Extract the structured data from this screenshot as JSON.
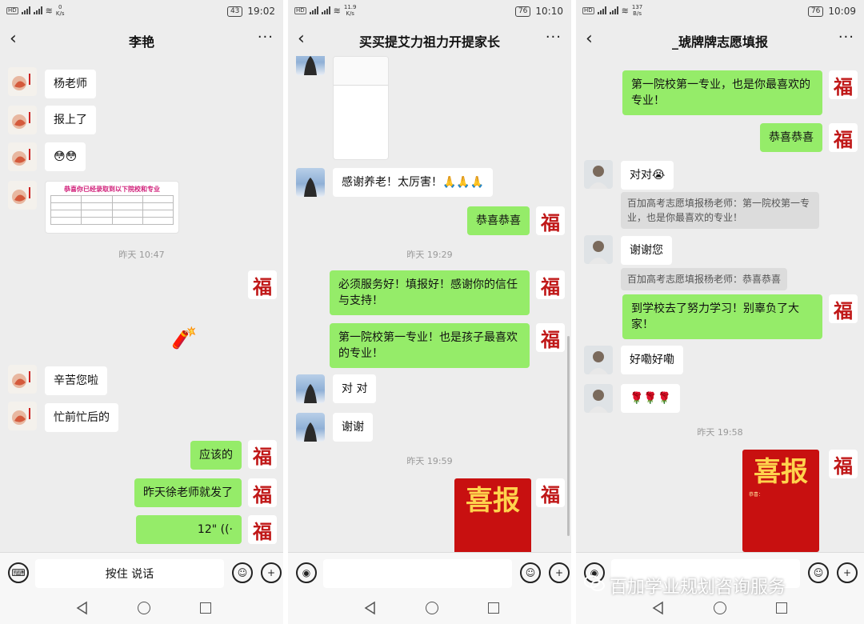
{
  "panels": [
    {
      "status": {
        "net": "0",
        "unit": "K/s",
        "battery": "43",
        "time": "19:02"
      },
      "title": "李艳",
      "messages": {
        "m1": "杨老师",
        "m2": "报上了",
        "m3": "😳😳",
        "card_title": "恭喜你已经录取到以下院校和专业",
        "time1": "昨天 10:47",
        "m5": "辛苦您啦",
        "m6": "忙前忙后的",
        "r1": "应该的",
        "r2": "昨天徐老师就发了",
        "voice": "12\""
      },
      "input": {
        "press_to_talk": "按住 说话"
      }
    },
    {
      "status": {
        "net": "11.9",
        "unit": "K/s",
        "battery": "76",
        "time": "10:10"
      },
      "title": "买买提艾力祖力开提家长",
      "messages": {
        "m1": "感谢养老！太厉害！🙏🙏🙏",
        "r1": "恭喜恭喜",
        "time1": "昨天 19:29",
        "r2": "必须服务好！填报好！感谢你的信任与支持！",
        "r3": "第一院校第一专业！也是孩子最喜欢的专业！",
        "m2": "对 对",
        "m3": "谢谢",
        "time2": "昨天 19:59",
        "poster_text": "喜报"
      }
    },
    {
      "status": {
        "net": "137",
        "unit": "B/s",
        "battery": "76",
        "time": "10:09"
      },
      "title": "_琥牌牌志愿填报",
      "messages": {
        "r1": "第一院校第一专业，也是你最喜欢的专业！",
        "r2": "恭喜恭喜",
        "m1": "对对😭",
        "sys1": "百加高考志愿填报杨老师：第一院校第一专业，也是你最喜欢的专业！",
        "m2": "谢谢您",
        "sys2": "百加高考志愿填报杨老师：恭喜恭喜",
        "r3": "到学校去了努力学习！别辜负了大家！",
        "m3": "好嘞好嘞",
        "m4": "🌹🌹🌹",
        "time1": "昨天 19:58",
        "poster_big": "喜报",
        "poster_line": "恭喜："
      }
    }
  ],
  "fu_char": "福",
  "watermark": "百加学业规划咨询服务"
}
